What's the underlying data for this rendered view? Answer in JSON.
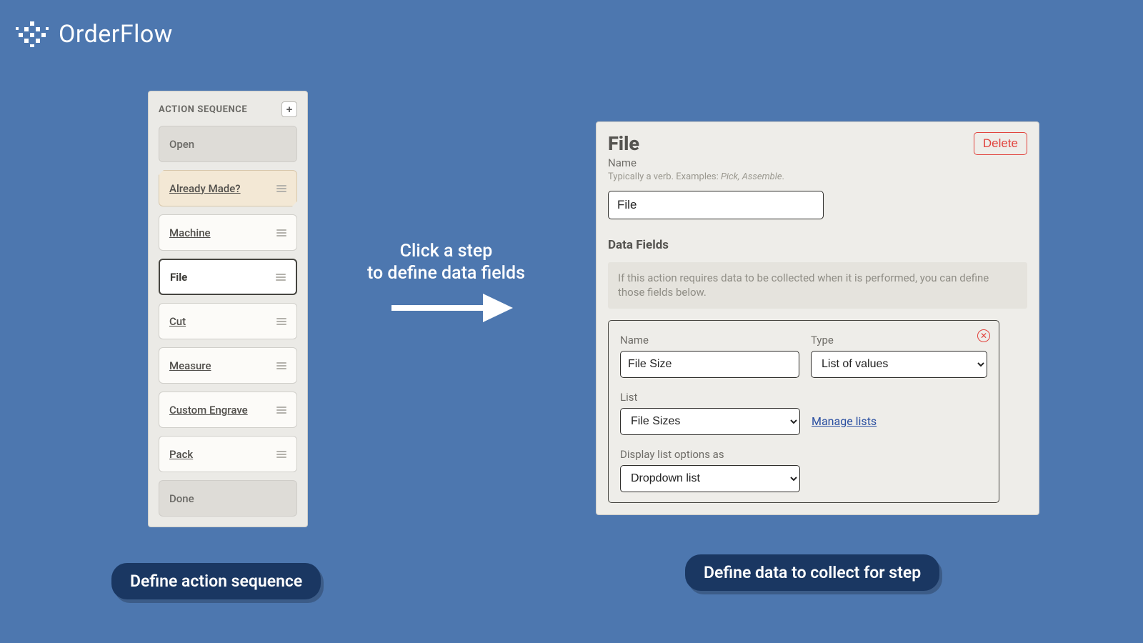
{
  "brand": {
    "name": "OrderFlow"
  },
  "sequence": {
    "title": "ACTION SEQUENCE",
    "addIcon": "+",
    "steps": [
      {
        "label": "Open",
        "kind": "terminal"
      },
      {
        "label": "Already Made?",
        "kind": "decision"
      },
      {
        "label": "Machine",
        "kind": "normal"
      },
      {
        "label": "File",
        "kind": "selected"
      },
      {
        "label": "Cut",
        "kind": "normal"
      },
      {
        "label": "Measure",
        "kind": "normal"
      },
      {
        "label": "Custom Engrave",
        "kind": "normal"
      },
      {
        "label": "Pack",
        "kind": "normal"
      },
      {
        "label": "Done",
        "kind": "terminal"
      }
    ]
  },
  "hint": {
    "line1": "Click a step",
    "line2": "to define data fields"
  },
  "detail": {
    "title": "File",
    "deleteLabel": "Delete",
    "nameLabel": "Name",
    "nameHelperPrefix": "Typically a verb. Examples: ",
    "nameHelperExamples": "Pick, Assemble",
    "nameValue": "File",
    "dataFieldsTitle": "Data Fields",
    "dataFieldsInfo": "If this action requires data to be collected when it is performed, you can define those fields below.",
    "field": {
      "nameLabel": "Name",
      "nameValue": "File Size",
      "typeLabel": "Type",
      "typeValue": "List of values",
      "listLabel": "List",
      "listValue": "File Sizes",
      "manageLabel": "Manage lists",
      "displayLabel": "Display list options as",
      "displayValue": "Dropdown list"
    }
  },
  "captions": {
    "left": "Define action sequence",
    "right": "Define data to collect for step"
  }
}
